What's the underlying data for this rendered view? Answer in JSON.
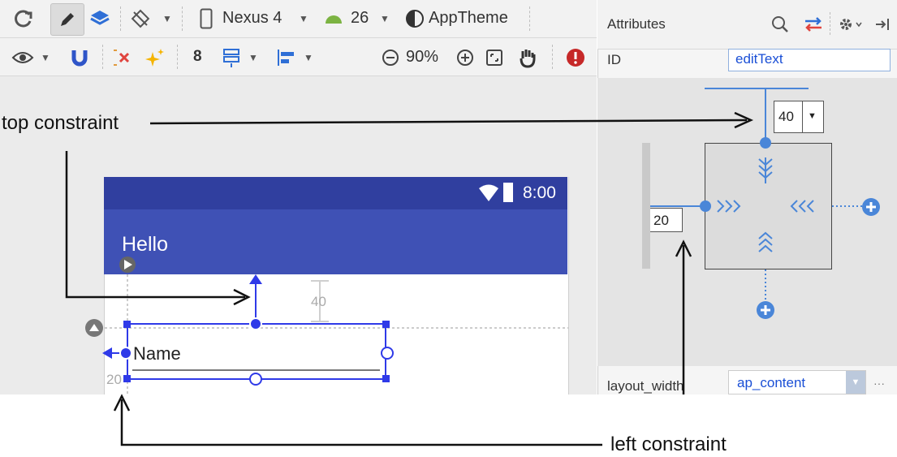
{
  "toolbar_top": {
    "device": "Nexus 4",
    "api": "26",
    "theme": "AppTheme"
  },
  "toolbar_second": {
    "margin_value": "8",
    "zoom": "90%"
  },
  "phone": {
    "status_time": "8:00",
    "app_title": "Hello",
    "edit_text": "Name",
    "top_margin_label": "40",
    "left_margin_label": "20"
  },
  "attributes": {
    "header": "Attributes",
    "id_label": "ID",
    "id_value": "editText",
    "top_margin": "40",
    "left_margin": "20",
    "layout_width_label": "layout_width",
    "layout_width_value": "ap_content",
    "more": "···"
  },
  "annotations": {
    "top_constraint": "top constraint",
    "left_constraint": "left constraint"
  },
  "colors": {
    "blueprint": "#2f3ae8",
    "inspector_blue": "#4a86d8",
    "appbar": "#3f51b5",
    "statusbar": "#303f9f",
    "error": "#c62828"
  }
}
